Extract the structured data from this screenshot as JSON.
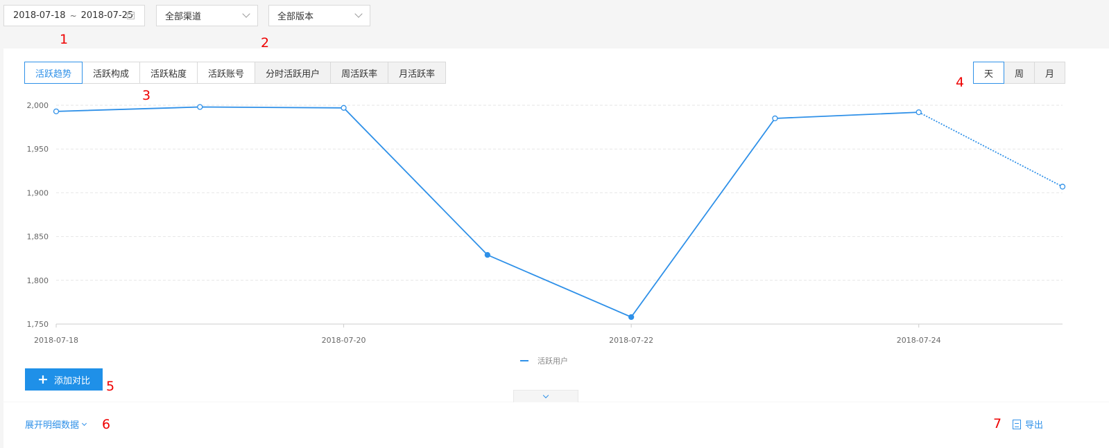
{
  "filters": {
    "date_start": "2018-07-18",
    "date_separator": "~",
    "date_end": "2018-07-25",
    "channel": "全部渠道",
    "version": "全部版本"
  },
  "tabs": [
    {
      "label": "活跃趋势",
      "active": true
    },
    {
      "label": "活跃构成"
    },
    {
      "label": "活跃粘度"
    },
    {
      "label": "活跃账号"
    },
    {
      "label": "分时活跃用户"
    },
    {
      "label": "周活跃率"
    },
    {
      "label": "月活跃率"
    }
  ],
  "period_tabs": [
    {
      "label": "天",
      "active": true
    },
    {
      "label": "周"
    },
    {
      "label": "月"
    }
  ],
  "annotations": [
    "1",
    "2",
    "3",
    "4",
    "5",
    "6",
    "7"
  ],
  "chart_data": {
    "type": "line",
    "x": [
      "2018-07-18",
      "2018-07-19",
      "2018-07-20",
      "2018-07-21",
      "2018-07-22",
      "2018-07-23",
      "2018-07-24",
      "2018-07-25"
    ],
    "x_tick_labels": [
      "2018-07-18",
      "2018-07-20",
      "2018-07-22",
      "2018-07-24"
    ],
    "series": [
      {
        "name": "活跃用户",
        "values": [
          1993,
          1998,
          1997,
          1829,
          1758,
          1985,
          1992,
          1907
        ],
        "color": "#2e90e8"
      }
    ],
    "ylim": [
      1750,
      2000
    ],
    "y_ticks": [
      "2,000",
      "1,950",
      "1,900",
      "1,850",
      "1,800",
      "1,750"
    ],
    "grid": true,
    "legend": "bottom-center",
    "dotted_last_segment": true
  },
  "actions": {
    "add_compare": "添加对比",
    "expand_details": "展开明细数据",
    "export": "导出"
  }
}
